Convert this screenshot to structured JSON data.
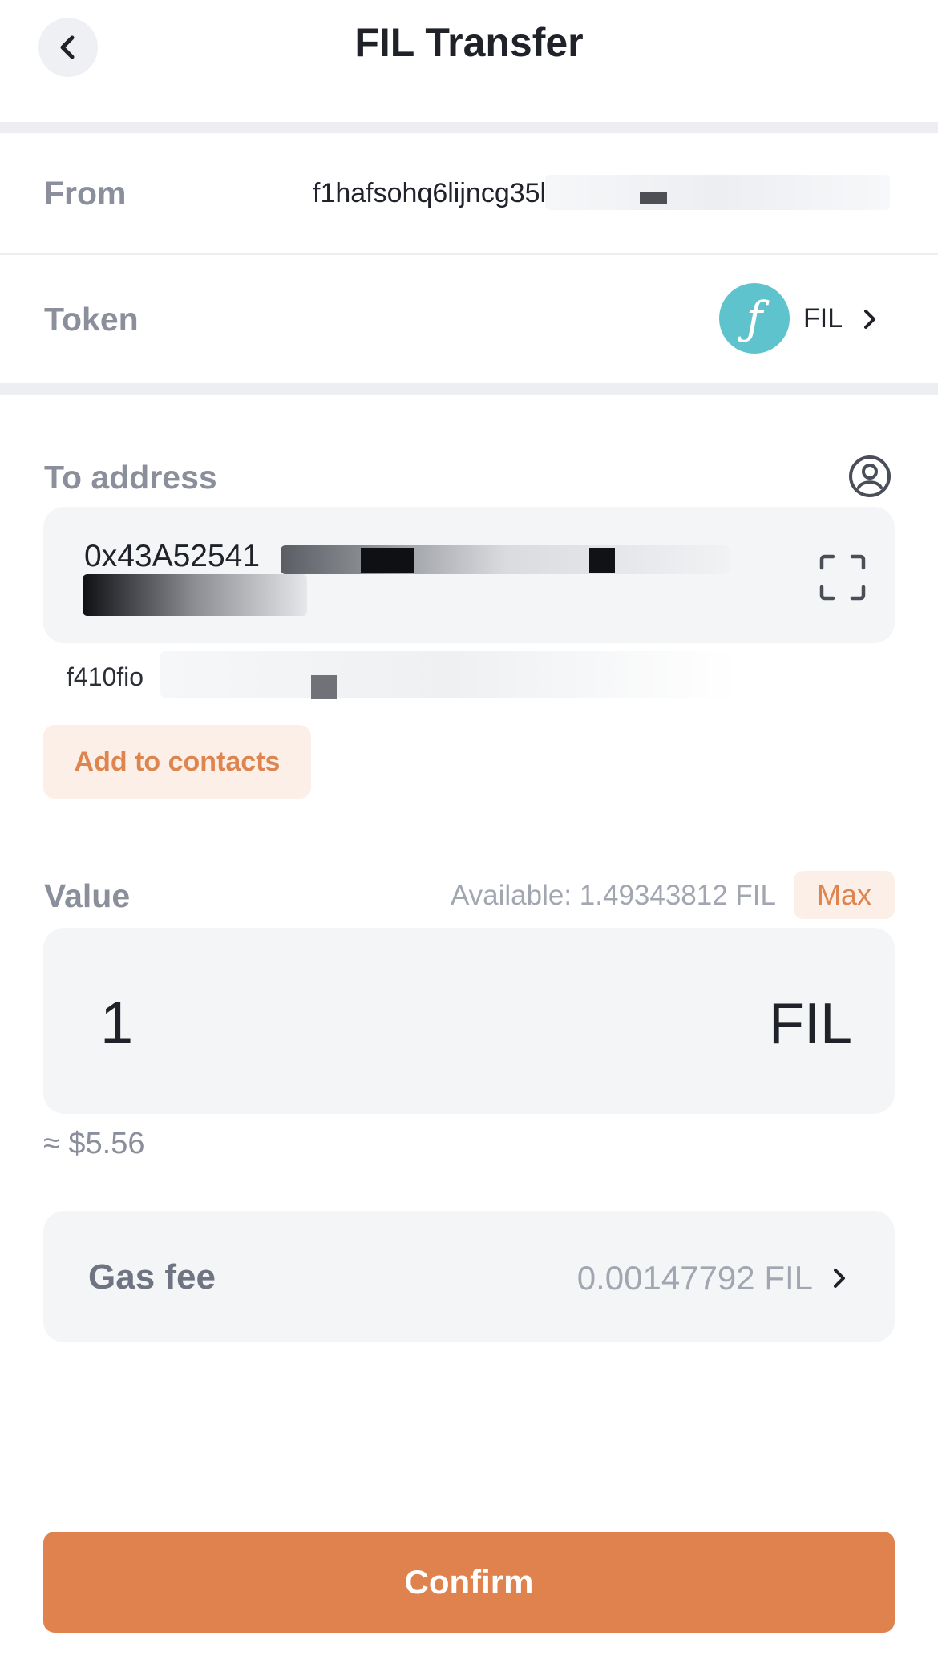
{
  "header": {
    "title": "FIL Transfer",
    "back_icon": "chevron-left-icon"
  },
  "from": {
    "label": "From",
    "value": "f1hafsohq6lijncg35l.."
  },
  "token": {
    "label": "Token",
    "icon": "filecoin-logo",
    "symbol": "FIL",
    "chevron_icon": "chevron-right-icon"
  },
  "to_address": {
    "label": "To address",
    "contact_icon": "contact-book-icon",
    "value": "0x43A52541",
    "scan_icon": "scan-qr-icon",
    "fil_address": "f410fio",
    "add_contacts_label": "Add to contacts"
  },
  "value": {
    "label": "Value",
    "available": "Available: 1.49343812 FIL",
    "max_label": "Max",
    "amount": "1",
    "unit": "FIL",
    "fiat": "≈ $5.56"
  },
  "gas": {
    "label": "Gas fee",
    "value": "0.00147792 FIL"
  },
  "confirm_label": "Confirm",
  "colors": {
    "accent": "#df824e",
    "accent_soft": "#fcefe7",
    "filecoin": "#5ec3cd"
  }
}
